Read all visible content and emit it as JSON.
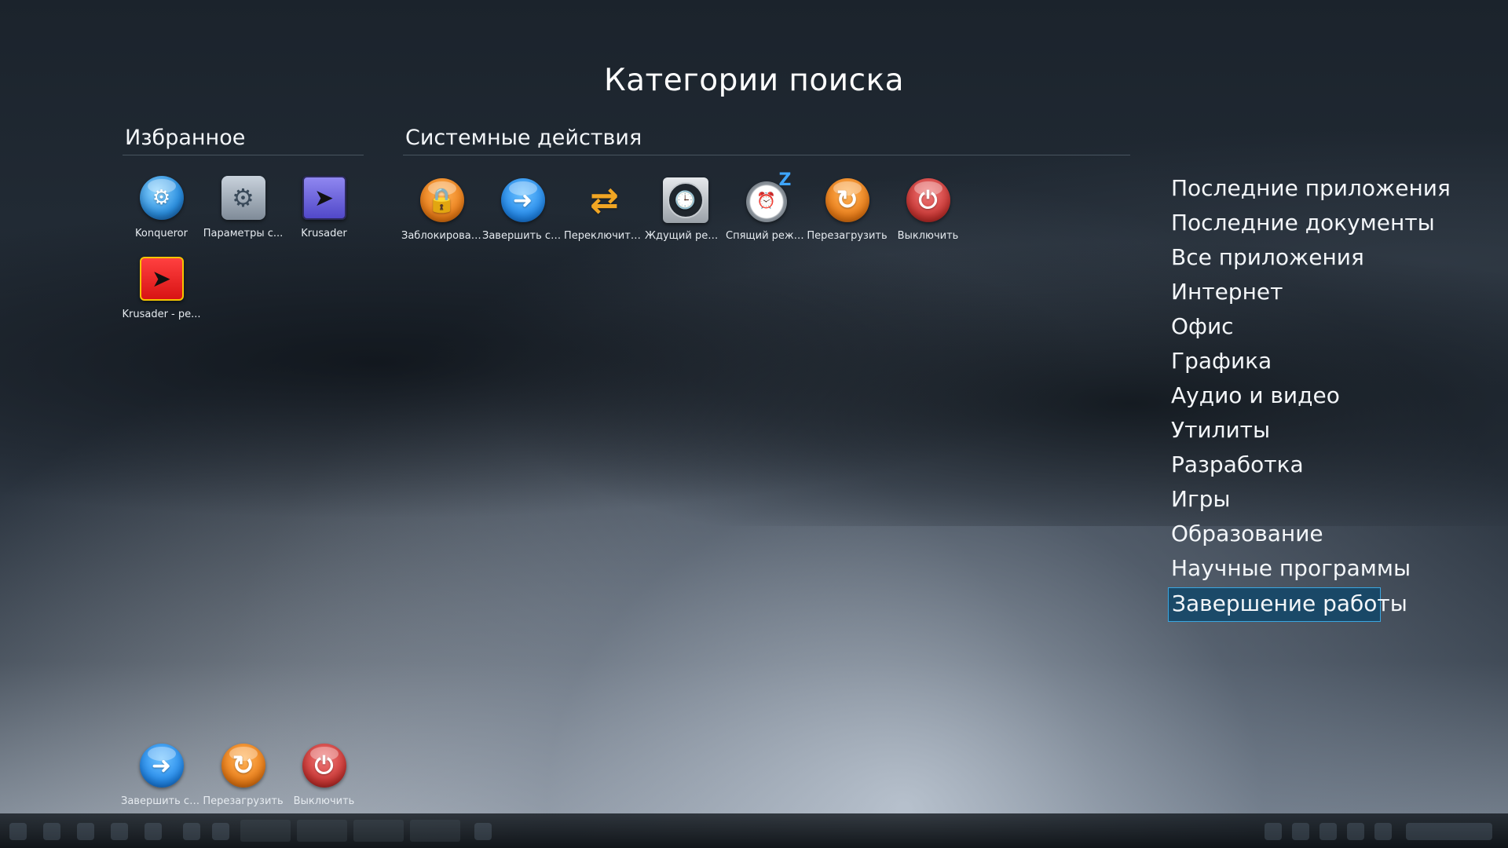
{
  "title": "Категории поиска",
  "favorites": {
    "heading": "Избранное",
    "items": [
      {
        "label": "Konqueror",
        "icon": "konqueror-icon"
      },
      {
        "label": "Параметры с...",
        "icon": "system-settings-icon"
      },
      {
        "label": "Krusader",
        "icon": "krusader-icon"
      },
      {
        "label": "Krusader - ре...",
        "icon": "krusader-root-icon"
      }
    ]
  },
  "system_actions": {
    "heading": "Системные действия",
    "items": [
      {
        "label": "Заблокировать",
        "icon": "lock-icon",
        "glyph": "🔒"
      },
      {
        "label": "Завершить се...",
        "icon": "logout-arrow-icon",
        "glyph": "➜"
      },
      {
        "label": "Переключить...",
        "icon": "switch-user-icon",
        "glyph": "⇄"
      },
      {
        "label": "Ждущий реж...",
        "icon": "clock-icon",
        "glyph": "🕒"
      },
      {
        "label": "Спящий режим",
        "icon": "sleep-clock-icon",
        "glyph": "⏰"
      },
      {
        "label": "Перезагрузить",
        "icon": "restart-icon",
        "glyph": "↻"
      },
      {
        "label": "Выключить",
        "icon": "power-icon",
        "glyph": "⏻"
      }
    ]
  },
  "bottom_actions": [
    {
      "label": "Завершить се...",
      "icon": "logout-arrow-icon",
      "glyph": "➜"
    },
    {
      "label": "Перезагрузить",
      "icon": "restart-icon",
      "glyph": "↻"
    },
    {
      "label": "Выключить",
      "icon": "power-icon",
      "glyph": "⏻"
    }
  ],
  "categories": [
    "Последние приложения",
    "Последние документы",
    "Все приложения",
    "Интернет",
    "Офис",
    "Графика",
    "Аудио и видео",
    "Утилиты",
    "Разработка",
    "Игры",
    "Образование",
    "Научные программы",
    "Завершение работы"
  ],
  "active_category": "Завершение работы",
  "colors": {
    "accent_border": "#3aa6e0",
    "accent_fill": "#124669",
    "orange": "#ea7a14",
    "blue": "#1f86ea",
    "red": "#c8322f"
  }
}
